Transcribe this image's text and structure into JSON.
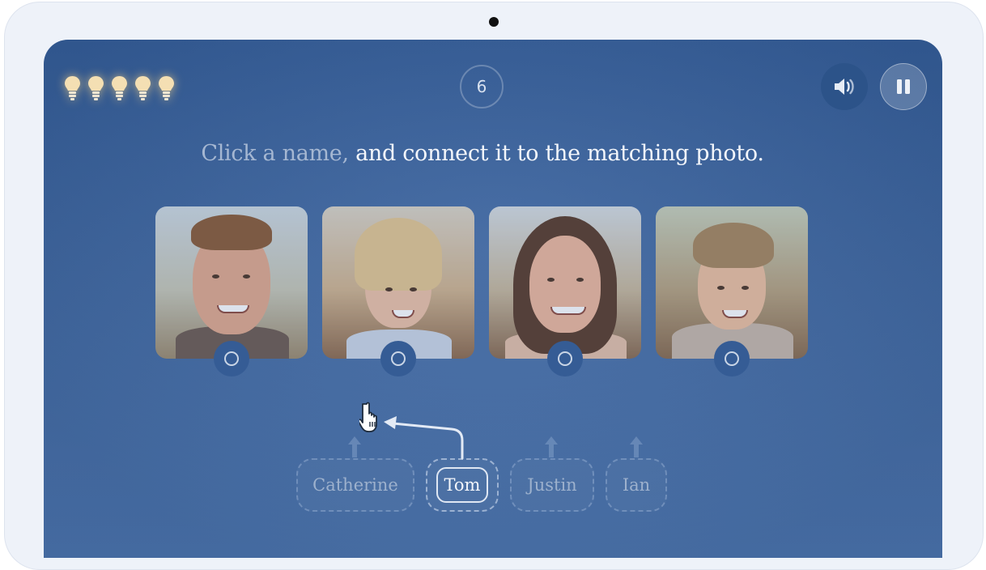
{
  "level": "6",
  "hints": {
    "count": 5,
    "color": "#f4dfb3"
  },
  "instruction": {
    "muted": "Click a name,",
    "strong": " and connect it to the matching photo."
  },
  "photos": [
    {
      "icon": "man-photo"
    },
    {
      "icon": "child-girl-photo"
    },
    {
      "icon": "woman-photo"
    },
    {
      "icon": "child-boy-photo"
    }
  ],
  "names": [
    "Catherine",
    "Tom",
    "Justin",
    "Ian"
  ],
  "active_name": "Tom",
  "colors": {
    "screen": "#3a62a0",
    "accent": "#f3f6fb",
    "muted": "#9db1cd"
  }
}
